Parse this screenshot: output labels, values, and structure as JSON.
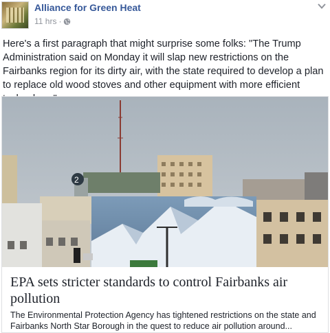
{
  "post": {
    "page_name": "Alliance for Green Heat",
    "timestamp": "11 hrs",
    "separator": "·",
    "audience_icon": "globe-icon",
    "options_icon": "chevron-down-icon",
    "text": "Here's a first paragraph that might surprise some folks: \"The Trump Administration said on Monday it will slap new restrictions on the Fairbanks region for its dirty air, with the state required to develop a plan to replace old wood stoves and other equipment with more efficient technology.\""
  },
  "link_card": {
    "image_icon": "city-skyline-photo",
    "title": "EPA sets stricter standards to control Fairbanks air pollution",
    "description": "The Environmental Protection Agency has tightened restrictions on the state and Fairbanks North Star Borough in the quest to reduce air pollution around..."
  },
  "colors": {
    "page_name": "#365899",
    "meta": "#90949c",
    "text": "#1d2129",
    "border": "#dddfe2"
  }
}
